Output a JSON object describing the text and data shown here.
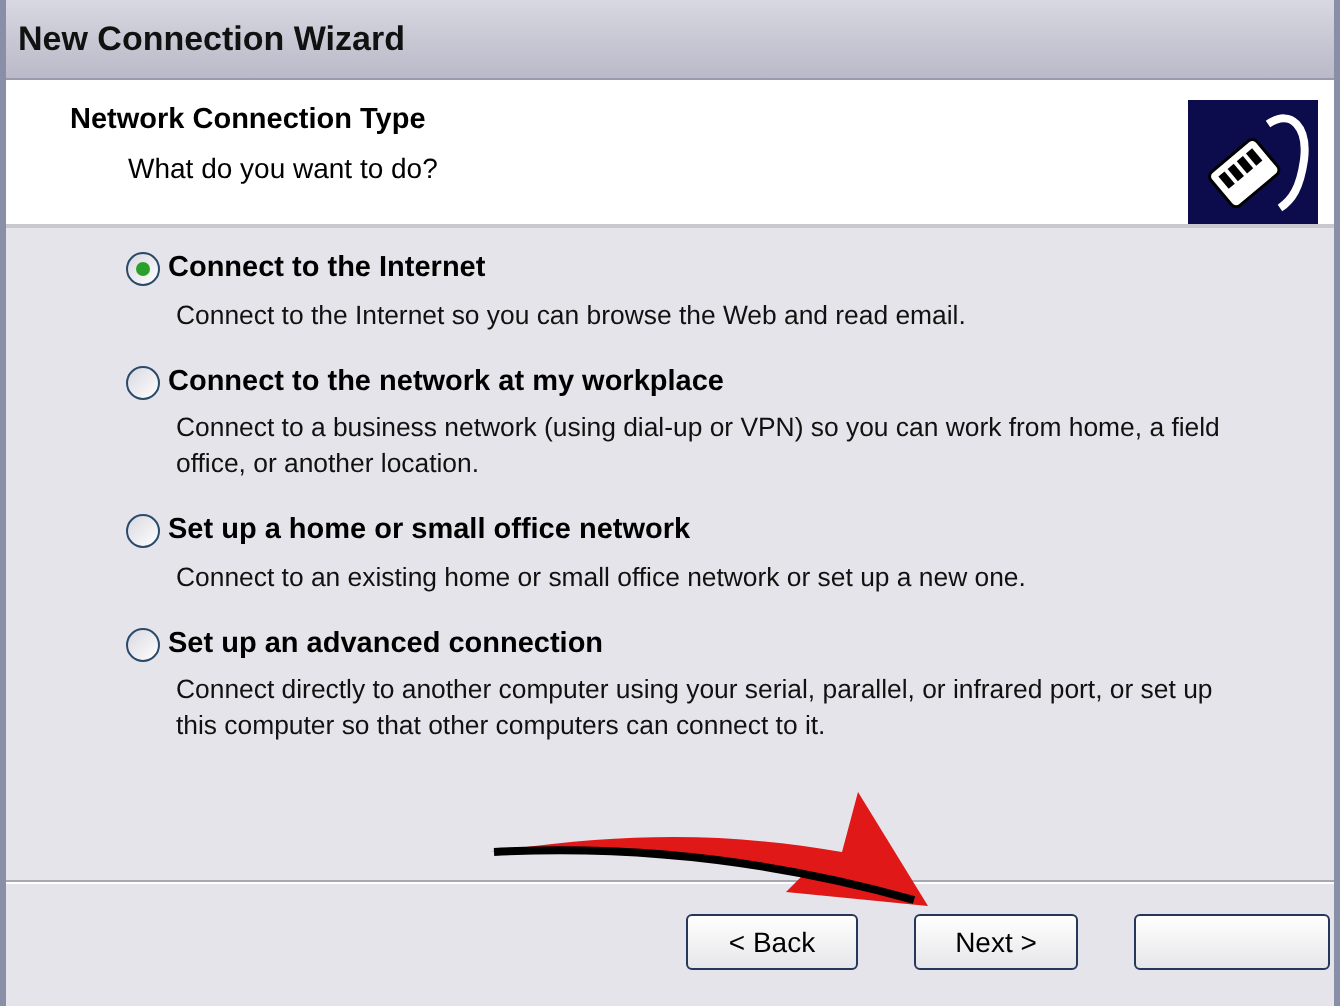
{
  "window": {
    "title": "New Connection Wizard"
  },
  "header": {
    "title": "Network Connection Type",
    "subtitle": "What do you want to do?"
  },
  "options": [
    {
      "label": "Connect to the Internet",
      "description": "Connect to the Internet so you can browse the Web and read email.",
      "selected": true
    },
    {
      "label": "Connect to the network at my workplace",
      "description": "Connect to a business network (using dial-up or VPN) so you can work from home, a field office, or another location.",
      "selected": false
    },
    {
      "label": "Set up a home or small office network",
      "description": "Connect to an existing home or small office network or set up a new one.",
      "selected": false
    },
    {
      "label": "Set up an advanced connection",
      "description": "Connect directly to another computer using your serial, parallel, or infrared port, or set up this computer so that other computers can connect to it.",
      "selected": false
    }
  ],
  "buttons": [
    {
      "kind": "labeled",
      "label": "< Back"
    },
    {
      "kind": "labeled",
      "label": "Next >"
    },
    {
      "kind": "blank"
    }
  ]
}
